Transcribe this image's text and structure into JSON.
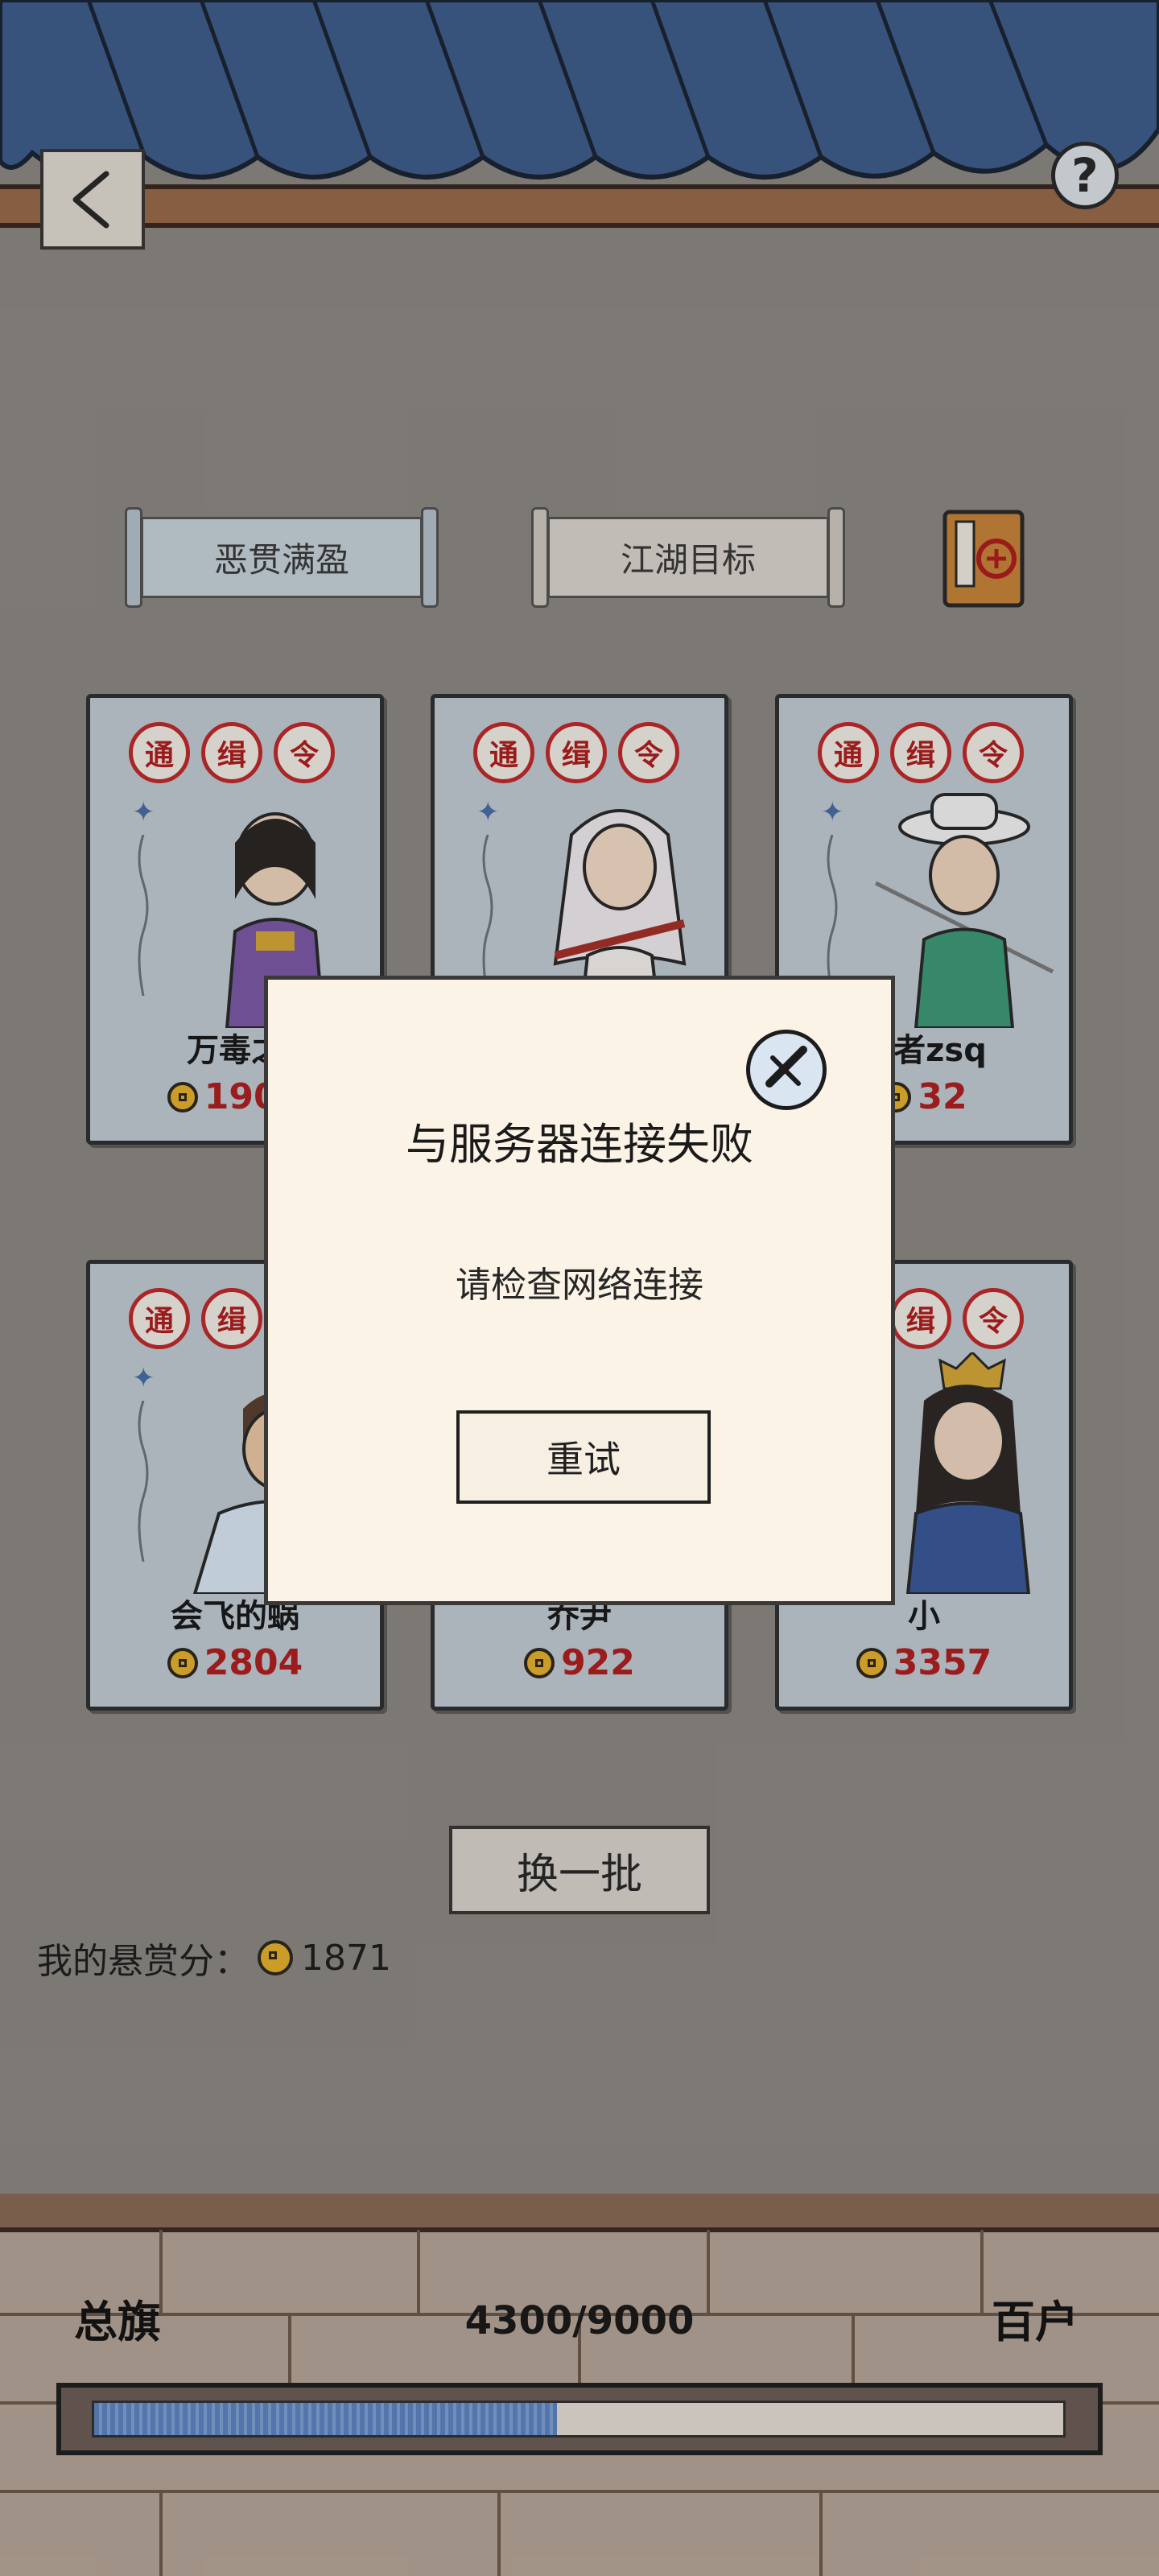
{
  "header": {
    "back_icon": "chevron-left-icon",
    "help_icon": "question-icon",
    "help_label": "?"
  },
  "tabs": [
    {
      "label": "恶贯满盈"
    },
    {
      "label": "江湖目标"
    }
  ],
  "book_icon": "book-icon",
  "card_tags": [
    "通",
    "缉",
    "令"
  ],
  "cards": [
    {
      "name": "万毒之",
      "score": "1902"
    },
    {
      "name": "",
      "score": ""
    },
    {
      "name": "魔者zsq",
      "score": "32"
    },
    {
      "name": "会飞的蜗",
      "score": "2804"
    },
    {
      "name": "乔尹",
      "score": "922"
    },
    {
      "name": "小",
      "score": "3357"
    }
  ],
  "refresh_label": "换一批",
  "my_bounty": {
    "label": "我的悬赏分：",
    "value": "1871"
  },
  "rank": {
    "current": "总旗",
    "next": "百户",
    "progress_text": "4300/9000",
    "progress_fraction": 0.4778
  },
  "dialog": {
    "title": "与服务器连接失败",
    "message": "请检查网络连接",
    "retry_label": "重试",
    "close_icon": "close-icon"
  },
  "colors": {
    "accent_red": "#b12020",
    "card_bg": "#c3ccd5",
    "dialog_bg": "#fbf3e6",
    "progress_blue": "#5f86c4"
  }
}
